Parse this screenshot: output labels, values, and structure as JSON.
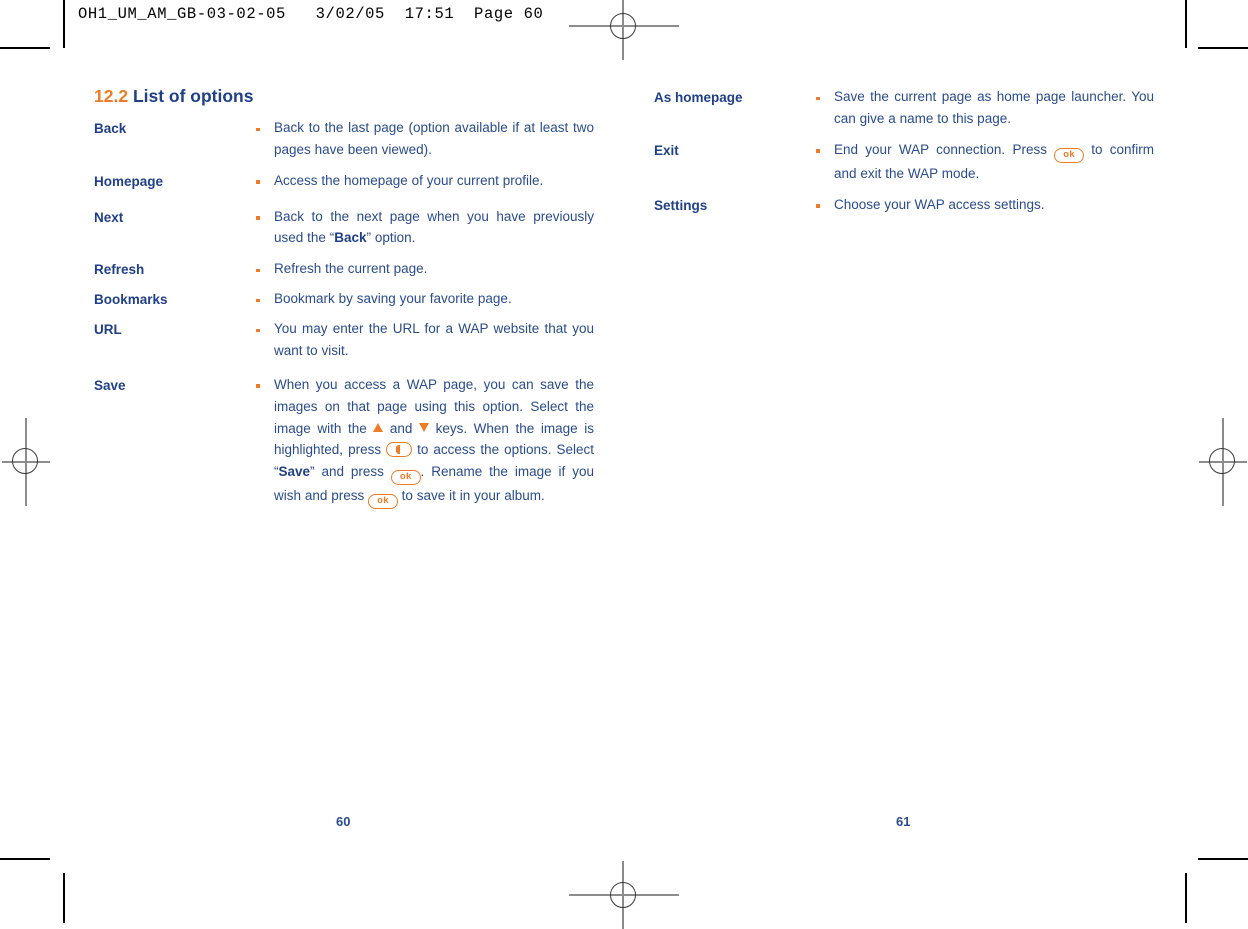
{
  "prepress": {
    "slug": "OH1_UM_AM_GB-03-02-05   3/02/05  17:51  Page 60"
  },
  "section": {
    "number": "12.2",
    "title": "List of options"
  },
  "left_column": {
    "options": [
      {
        "label": "Back",
        "description": "Back to the last page (option available if at least two pages have been viewed)."
      },
      {
        "label": "Homepage",
        "description": "Access the homepage of your current profile."
      },
      {
        "label": "Next",
        "description_before": "Back to the next page when you have previously used the “",
        "emphasis": "Back",
        "description_after": "” option."
      },
      {
        "label": "Refresh",
        "description": "Refresh the current page."
      },
      {
        "label": "Bookmarks",
        "description": "Bookmark by saving your favorite page."
      },
      {
        "label": "URL",
        "description": "You may enter the URL for a WAP website that you want to visit."
      },
      {
        "label": "Save",
        "save_text": {
          "p1": "When you access a WAP page, you can save the images on that page using this option. Select the image with the ",
          "p2": " and ",
          "p3": " keys. When the image is highlighted, press ",
          "p4": " to access the options. Select “",
          "emphasis": "Save",
          "p5": "” and press ",
          "p6": ". Rename the image if you wish and press ",
          "p7": " to save it in your album."
        }
      }
    ]
  },
  "right_column": {
    "options": [
      {
        "label": "As homepage",
        "description": "Save the current page as home page launcher. You can give a name to this page."
      },
      {
        "label": "Exit",
        "exit_text": {
          "p1": "End your WAP connection. Press ",
          "p2": " to confirm and exit the WAP mode."
        }
      },
      {
        "label": "Settings",
        "description": "Choose your WAP access settings."
      }
    ]
  },
  "keys": {
    "ok_label": "ok",
    "up_key": "up-arrow-key",
    "down_key": "down-arrow-key",
    "soft_key": "left-soft-key"
  },
  "folios": {
    "left": "60",
    "right": "61"
  },
  "colors": {
    "accent_orange": "#EE7B25",
    "body_navy": "#2A4B8D",
    "heading_navy": "#1F3F87"
  }
}
